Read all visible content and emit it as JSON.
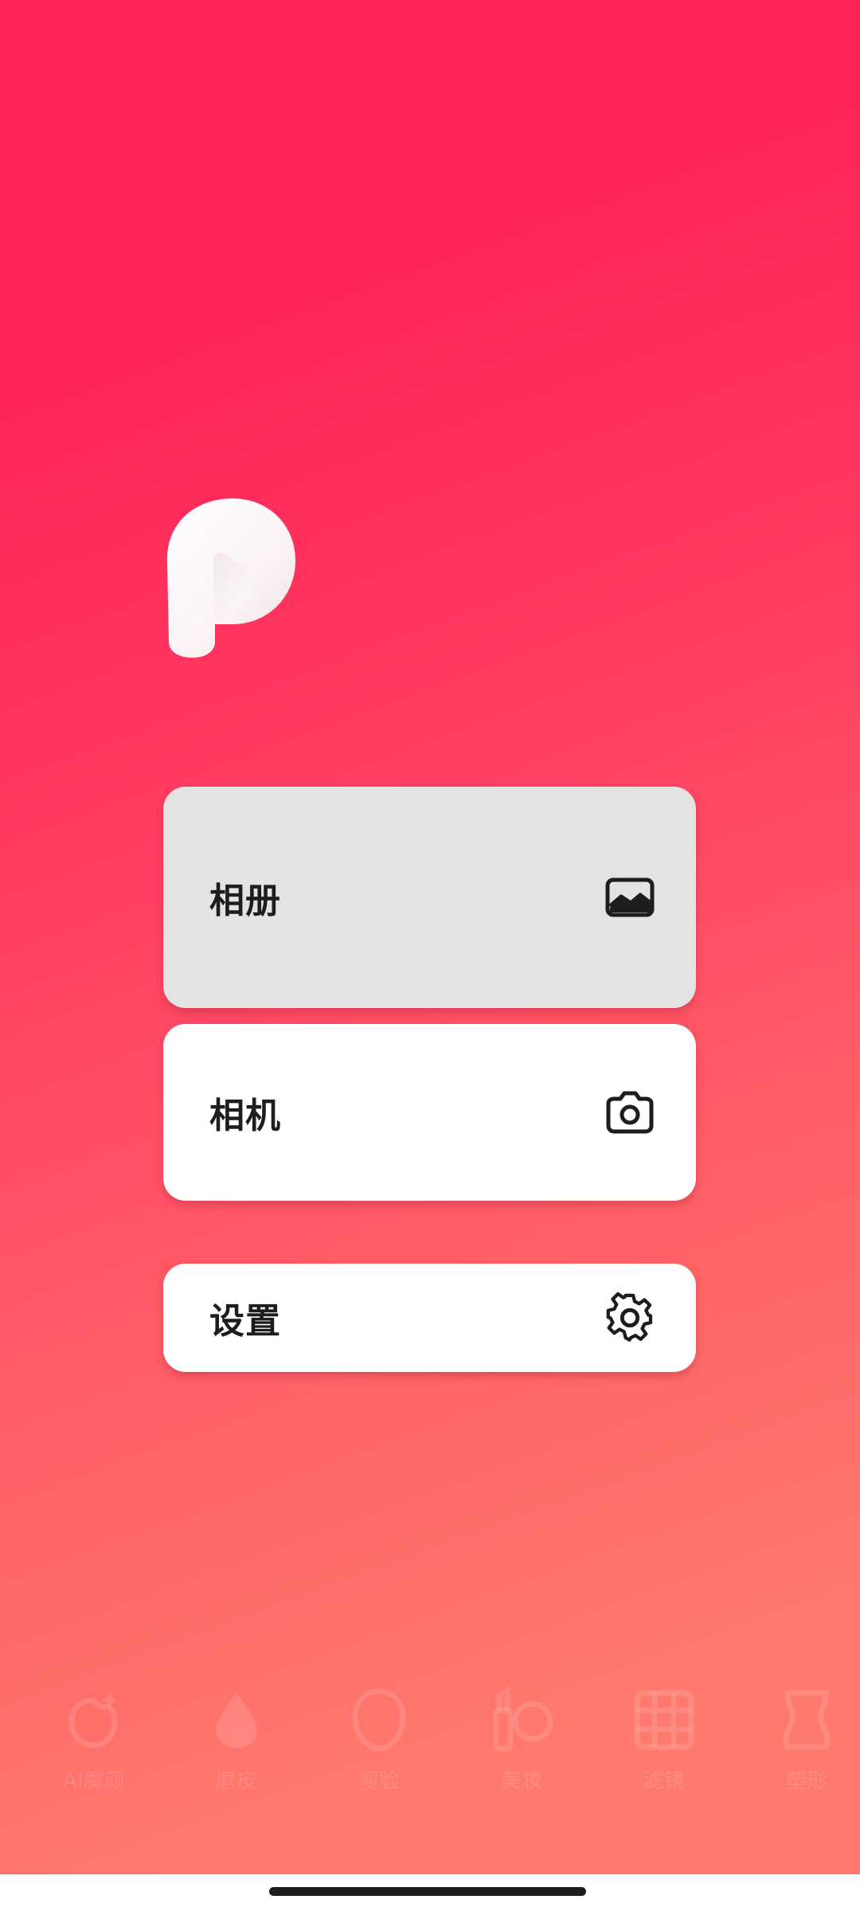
{
  "menu": {
    "album_label": "相册",
    "camera_label": "相机",
    "settings_label": "设置"
  },
  "icons": {
    "album": "image-icon",
    "camera": "camera-icon",
    "settings": "gear-icon",
    "logo": "app-logo-p"
  },
  "bottom_tools": [
    {
      "label": "AI魔颜",
      "icon": "face-sparkle-icon"
    },
    {
      "label": "磨皮",
      "icon": "drop-icon"
    },
    {
      "label": "瘦脸",
      "icon": "face-outline-icon"
    },
    {
      "label": "美妆",
      "icon": "lipstick-icon"
    },
    {
      "label": "滤镜",
      "icon": "grid-icon"
    },
    {
      "label": "塑形",
      "icon": "body-icon"
    }
  ],
  "colors": {
    "gradient_top": "#ff2358",
    "gradient_bottom": "#ff7a6e",
    "card": "#ffffff",
    "card_pressed": "#e3e3e3",
    "label_text": "#1d1d1d"
  }
}
